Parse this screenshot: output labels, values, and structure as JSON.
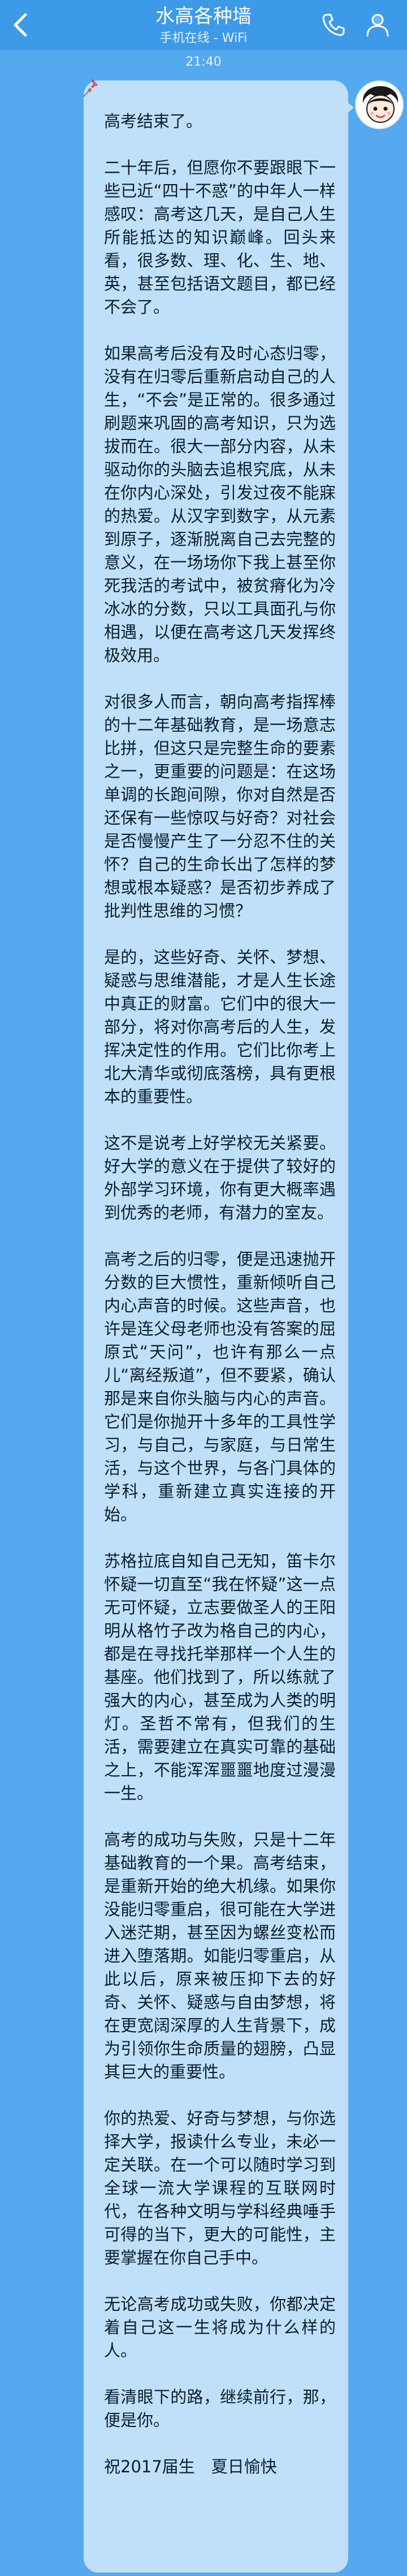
{
  "header": {
    "title": "水高各种墙",
    "subtitle": "手机在线 - WiFi",
    "back_icon": "chevron-left-icon",
    "call_icon": "phone-icon",
    "profile_icon": "person-icon",
    "bar_color": "#3d9ae8"
  },
  "chat": {
    "timestamp": "21:40",
    "bubble_color": "#bfe0f8",
    "background_color": "#55a9ee",
    "message": {
      "paragraphs": [
        "高考结束了。",
        "二十年后，但愿你不要跟眼下一些已近“四十不惑”的中年人一样感叹：高考这几天，是自己人生所能抵达的知识巅峰。回头来看，很多数、理、化、生、地、英，甚至包括语文题目，都已经不会了。",
        "如果高考后没有及时心态归零，没有在归零后重新启动自己的人生，“不会”是正常的。很多通过刷题来巩固的高考知识，只为选拔而在。很大一部分内容，从未驱动你的头脑去追根究底，从未在你内心深处，引发过夜不能寐的热爱。从汉字到数字，从元素到原子，逐渐脱离自己去完整的意义，在一场场你下我上甚至你死我活的考试中，被贫瘠化为冷冰冰的分数，只以工具面孔与你相遇，以便在高考这几天发挥终极效用。",
        "对很多人而言，朝向高考指挥棒的十二年基础教育，是一场意志比拼，但这只是完整生命的要素之一，更重要的问题是：在这场单调的长跑间隙，你对自然是否还保有一些惊叹与好奇？对社会是否慢慢产生了一分忍不住的关怀？自己的生命长出了怎样的梦想或根本疑惑？是否初步养成了批判性思维的习惯？",
        "是的，这些好奇、关怀、梦想、疑惑与思维潜能，才是人生长途中真正的财富。它们中的很大一部分，将对你高考后的人生，发挥决定性的作用。它们比你考上北大清华或彻底落榜，具有更根本的重要性。",
        "这不是说考上好学校无关紧要。好大学的意义在于提供了较好的外部学习环境，你有更大概率遇到优秀的老师，有潜力的室友。",
        "高考之后的归零，便是迅速抛开分数的巨大惯性，重新倾听自己内心声音的时候。这些声音，也许是连父母老师也没有答案的屈原式“天问”，也许有那么一点儿“离经叛道”，但不要紧，确认那是来自你头脑与内心的声音。它们是你抛开十多年的工具性学习，与自己，与家庭，与日常生活，与这个世界，与各门具体的学科，重新建立真实连接的开始。",
        "苏格拉底自知自己无知，笛卡尔怀疑一切直至“我在怀疑”这一点无可怀疑，立志要做圣人的王阳明从格竹子改为格自己的内心，都是在寻找托举那样一个人生的基座。他们找到了，所以练就了强大的内心，甚至成为人类的明灯。圣哲不常有，但我们的生活，需要建立在真实可靠的基础之上，不能浑浑噩噩地度过漫漫一生。",
        "高考的成功与失败，只是十二年基础教育的一个果。高考结束，是重新开始的绝大机缘。如果你没能归零重启，很可能在大学进入迷茫期，甚至因为螺丝变松而进入堕落期。如能归零重启，从此以后，原来被压抑下去的好奇、关怀、疑惑与自由梦想，将在更宽阔深厚的人生背景下，成为引领你生命质量的翅膀，凸显其巨大的重要性。",
        "你的热爱、好奇与梦想，与你选择大学，报读什么专业，未必一定关联。在一个可以随时学习到全球一流大学课程的互联网时代，在各种文明与学科经典唾手可得的当下，更大的可能性，主要掌握在你自己手中。",
        "无论高考成功或失败，你都决定着自己这一生将成为什么样的人。",
        "看清眼下的路，继续前行，那，便是你。",
        "祝2017届生　夏日愉快"
      ]
    }
  }
}
